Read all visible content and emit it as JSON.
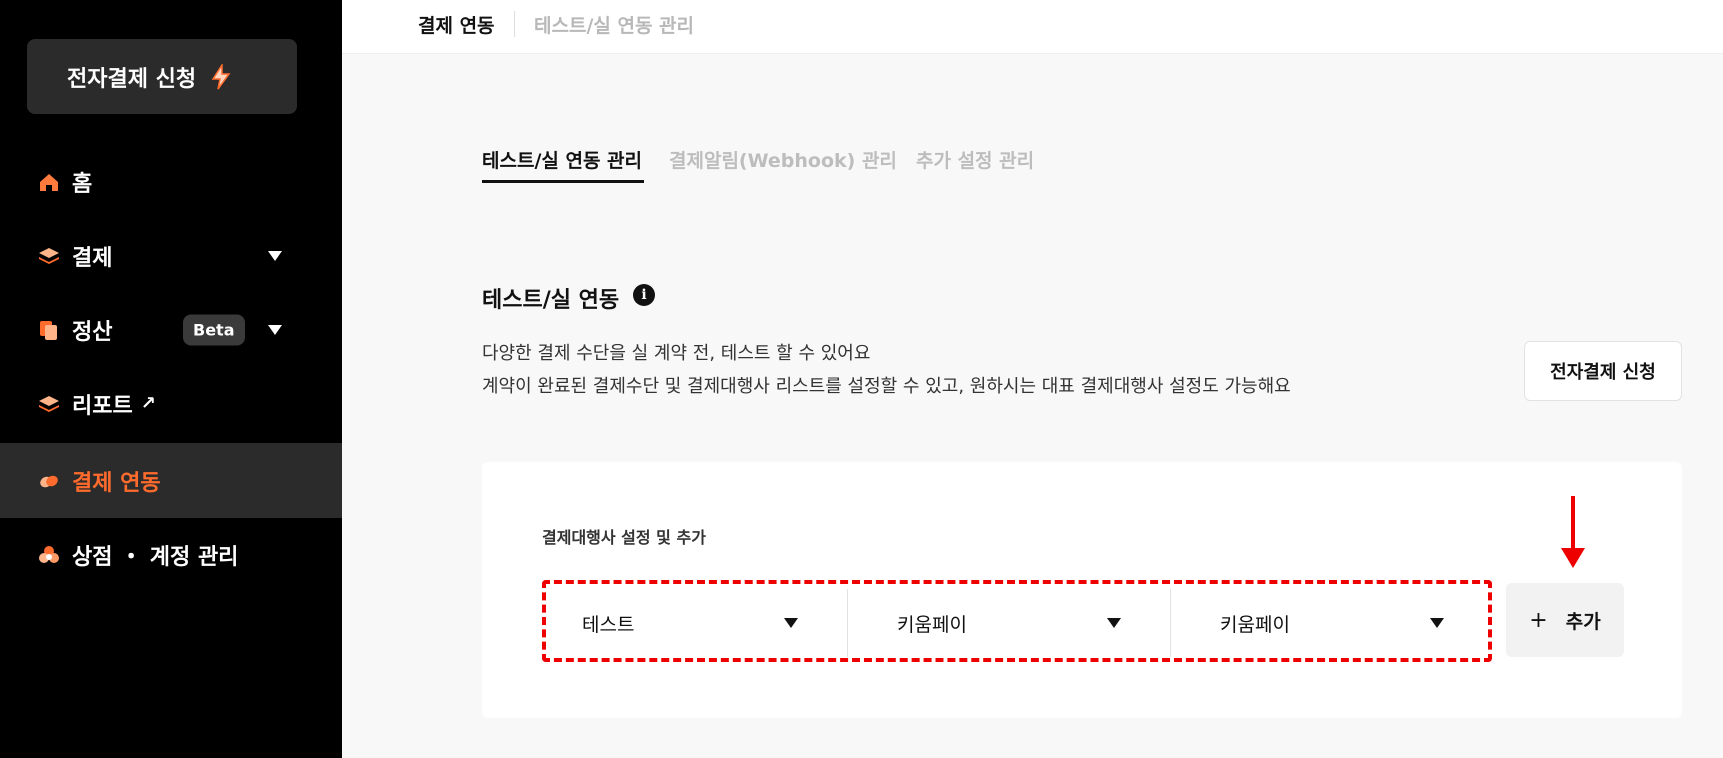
{
  "sidebar": {
    "apply_button": "전자결제 신청",
    "items": [
      {
        "label": "홈",
        "icon": "home-icon"
      },
      {
        "label": "결제",
        "icon": "layers-icon",
        "has_caret": true
      },
      {
        "label": "정산",
        "icon": "copy-icon",
        "badge": "Beta",
        "has_caret": true
      },
      {
        "label": "리포트",
        "icon": "layers-icon",
        "external": "↗"
      },
      {
        "label": "결제 연동",
        "icon": "link-icon",
        "active": true
      },
      {
        "label": "상점 ・ 계정 관리",
        "icon": "store-icon"
      }
    ]
  },
  "header": {
    "breadcrumb_current": "결제 연동",
    "breadcrumb_sub": "테스트/실 연동 관리"
  },
  "tabs": [
    {
      "label": "테스트/실 연동 관리",
      "active": true
    },
    {
      "label": "결제알림(Webhook) 관리",
      "active": false
    },
    {
      "label": "추가 설정 관리",
      "active": false
    }
  ],
  "section": {
    "title": "테스트/실 연동",
    "info_icon": "i",
    "desc_line1": "다양한 결제 수단을 실 계약 전, 테스트 할 수 있어요",
    "desc_line2": "계약이 완료된 결제수단 및 결제대행사 리스트를 설정할 수 있고, 원하시는 대표 결제대행사 설정도 가능해요",
    "apply_button": "전자결제 신청"
  },
  "pg_settings": {
    "label": "결제대행사 설정 및 추가",
    "selects": [
      {
        "value": "테스트"
      },
      {
        "value": "키움페이"
      },
      {
        "value": "키움페이"
      }
    ],
    "add_button_icon": "+",
    "add_button": "추가"
  },
  "colors": {
    "sidebar_bg": "#000000",
    "active_accent": "#ff6b2d",
    "annotation_red": "#e00000"
  }
}
